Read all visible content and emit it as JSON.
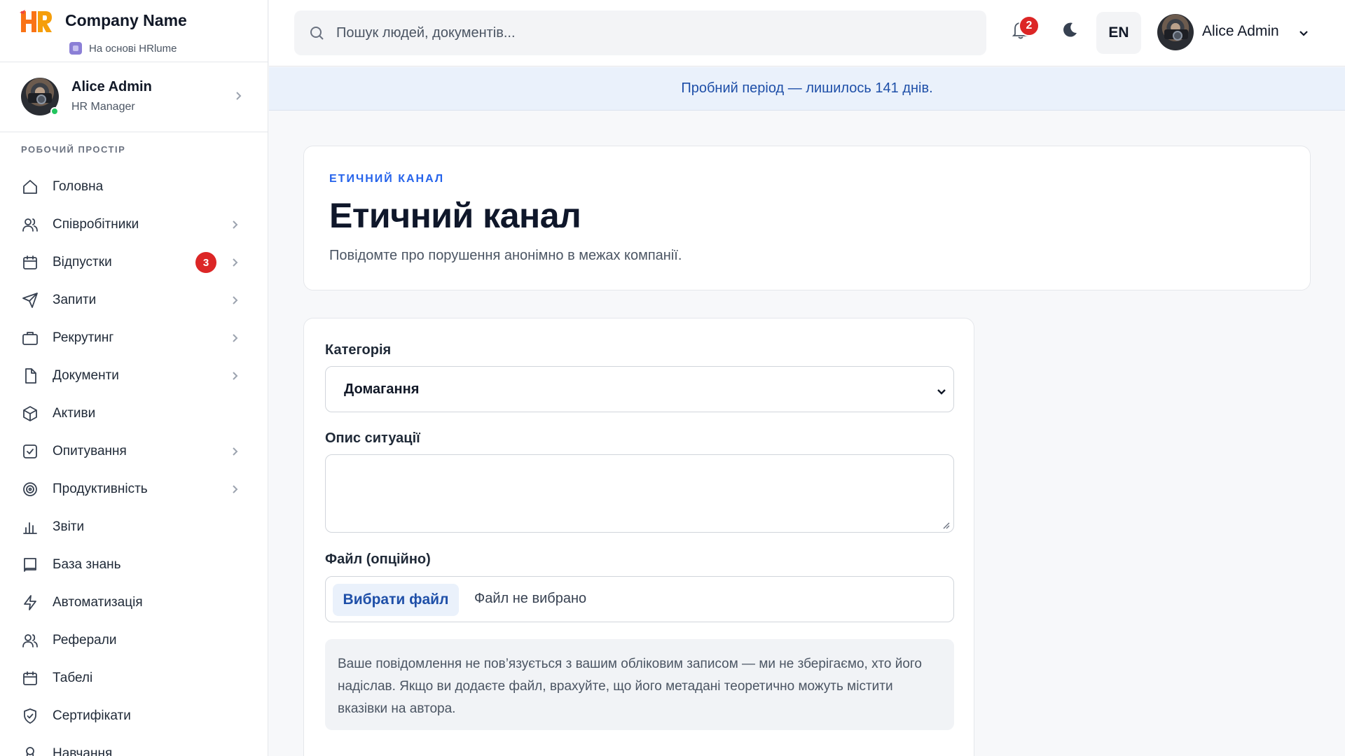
{
  "brand": {
    "name": "Company Name",
    "powered_by": "На основі HRlume"
  },
  "profile": {
    "name": "Alice Admin",
    "role": "HR Manager"
  },
  "sidebar": {
    "section_label": "РОБОЧИЙ ПРОСТІР",
    "items": [
      {
        "label": "Головна",
        "icon": "home-icon",
        "chevron": false
      },
      {
        "label": "Співробітники",
        "icon": "users-icon",
        "chevron": true
      },
      {
        "label": "Відпустки",
        "icon": "calendar-icon",
        "chevron": true,
        "badge": "3"
      },
      {
        "label": "Запити",
        "icon": "send-icon",
        "chevron": true
      },
      {
        "label": "Рекрутинг",
        "icon": "briefcase-icon",
        "chevron": true
      },
      {
        "label": "Документи",
        "icon": "file-icon",
        "chevron": true
      },
      {
        "label": "Активи",
        "icon": "box-icon",
        "chevron": false
      },
      {
        "label": "Опитування",
        "icon": "checkbox-icon",
        "chevron": true
      },
      {
        "label": "Продуктивність",
        "icon": "target-icon",
        "chevron": true
      },
      {
        "label": "Звіти",
        "icon": "bar-chart-icon",
        "chevron": false
      },
      {
        "label": "База знань",
        "icon": "book-icon",
        "chevron": false
      },
      {
        "label": "Автоматизація",
        "icon": "lightning-icon",
        "chevron": false
      },
      {
        "label": "Реферали",
        "icon": "referral-users-icon",
        "chevron": false
      },
      {
        "label": "Табелі",
        "icon": "timesheet-calendar-icon",
        "chevron": false
      },
      {
        "label": "Сертифікати",
        "icon": "shield-check-icon",
        "chevron": false
      },
      {
        "label": "Навчання",
        "icon": "award-icon",
        "chevron": false
      }
    ]
  },
  "topbar": {
    "search_placeholder": "Пошук людей, документів...",
    "notifications_count": "2",
    "language": "EN",
    "user_name": "Alice Admin"
  },
  "trial_banner": "Пробний період — лишилось 141 днів.",
  "header": {
    "kicker": "ЕТИЧНИЙ КАНАЛ",
    "title": "Етичний канал",
    "subtitle": "Повідомте про порушення анонімно в межах компанії."
  },
  "form": {
    "category_label": "Категорія",
    "category_value": "Домагання",
    "description_label": "Опис ситуації",
    "description_value": "",
    "file_label": "Файл (опційно)",
    "file_button": "Вибрати файл",
    "file_status": "Файл не вибрано",
    "notice": "Ваше повідомлення не пов’язується з вашим обліковим записом — ми не зберігаємо, хто його надіслав. Якщо ви додаєте файл, врахуйте, що його метадані теоретично можуть містити вказівки на автора."
  },
  "colors": {
    "accent": "#2563eb",
    "badge": "#dc2626",
    "banner_bg": "#eaf1fb"
  }
}
